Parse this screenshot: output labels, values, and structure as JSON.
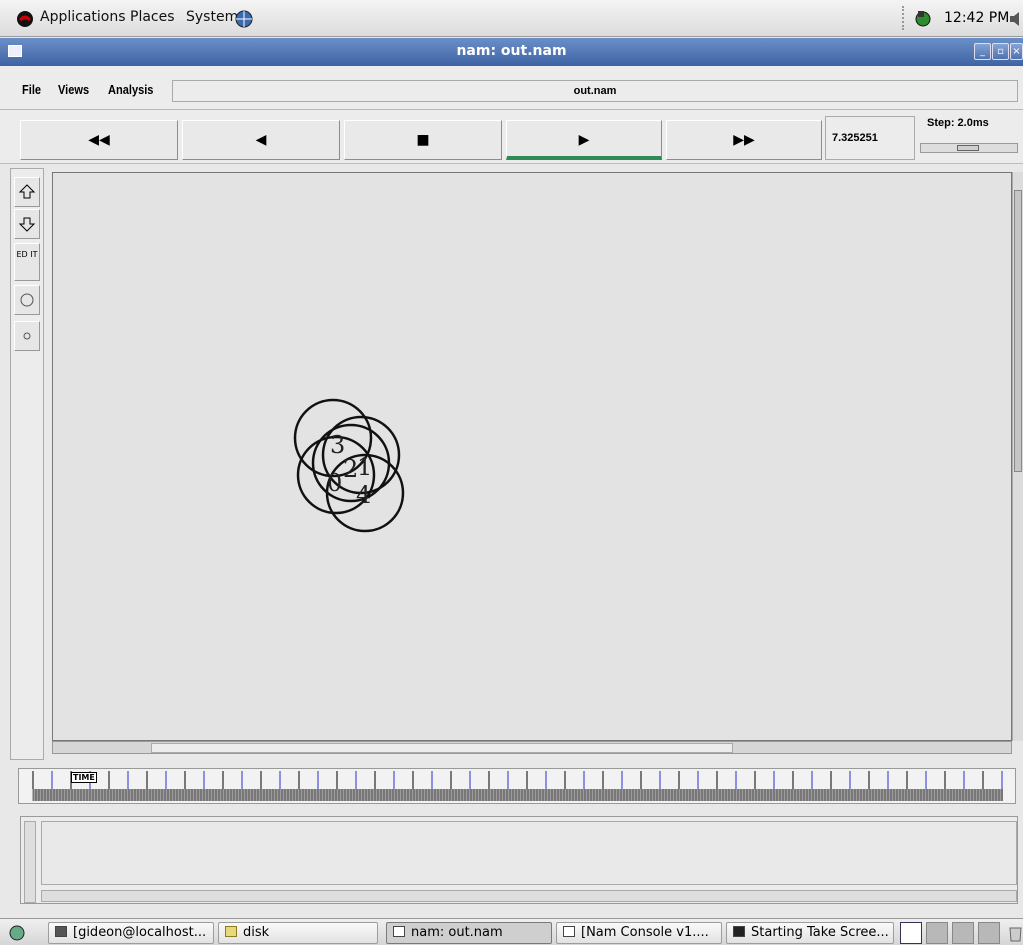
{
  "top_panel": {
    "menus": [
      "Applications",
      "Places",
      "System"
    ],
    "clock": "12:42 PM"
  },
  "window": {
    "title": "nam: out.nam"
  },
  "menubar": {
    "file": "File",
    "views": "Views",
    "analysis": "Analysis",
    "file_display": "out.nam"
  },
  "controls": {
    "rewind": "◀◀",
    "back": "◀",
    "stop": "■",
    "play": "▶",
    "fast_forward": "▶▶",
    "time_value": "7.325251",
    "step_label": "Step: 2.0ms"
  },
  "tools": {
    "edit_label": "ED IT"
  },
  "nodes": [
    {
      "label": "3"
    },
    {
      "label": "0"
    },
    {
      "label": "2"
    },
    {
      "label": "1"
    },
    {
      "label": "4"
    }
  ],
  "ruler": {
    "label": "TIME"
  },
  "taskbar": {
    "tasks": [
      "[gideon@localhost...",
      "disk",
      "nam: out.nam",
      "[Nam Console v1....",
      "Starting Take Scree..."
    ]
  }
}
